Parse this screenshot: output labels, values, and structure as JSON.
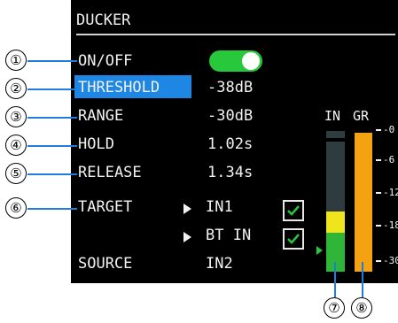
{
  "header": {
    "title": "DUCKER"
  },
  "params": {
    "onoff": {
      "label": "ON/OFF",
      "state": "on"
    },
    "threshold": {
      "label": "THRESHOLD",
      "value": "-38dB"
    },
    "range": {
      "label": "RANGE",
      "value": "-30dB"
    },
    "hold": {
      "label": "HOLD",
      "value": "1.02s"
    },
    "release": {
      "label": "RELEASE",
      "value": "1.34s"
    },
    "target": {
      "label": "TARGET",
      "items": [
        {
          "name": "IN1",
          "checked": true
        },
        {
          "name": "BT IN",
          "checked": true
        }
      ]
    },
    "source": {
      "label": "SOURCE",
      "value": "IN2"
    }
  },
  "meters": {
    "in_label": "IN",
    "gr_label": "GR",
    "scale": [
      "-0",
      "-6",
      "-12",
      "-18",
      "-30"
    ],
    "in_level": 0.46,
    "gr_level": 1.0,
    "colors": {
      "in_green": "#2fb537",
      "in_yellow": "#f0e51d",
      "gr_orange": "#f4a112",
      "meter_bg": "#2e3b3f"
    }
  },
  "callouts": [
    "①",
    "②",
    "③",
    "④",
    "⑤",
    "⑥",
    "⑦",
    "⑧"
  ],
  "accent": "#1e86e3"
}
